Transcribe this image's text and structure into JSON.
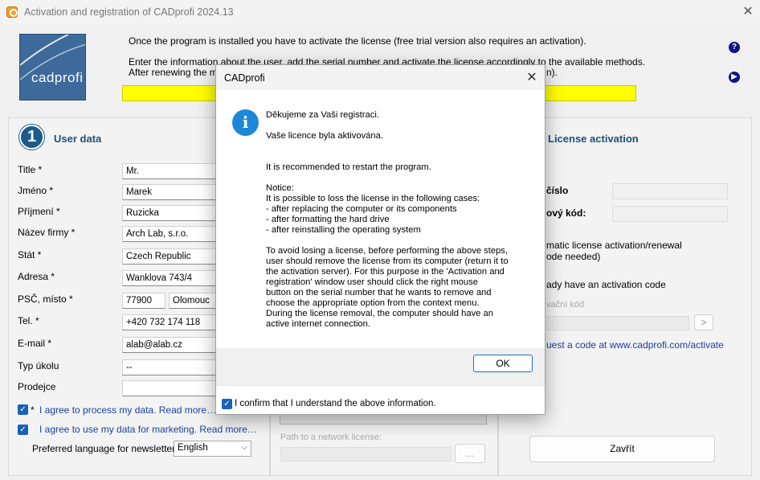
{
  "window": {
    "title": "Activation and registration of CADprofi  2024.13"
  },
  "logo": {
    "text": "cadprofi"
  },
  "intro": {
    "line1": "Once the program is installed you have to activate the license (free trial version also requires an activation).",
    "line2": "Enter the information about the user, add the serial number and activate the license accordingly to the available methods.",
    "line3": "After renewing the ma",
    "line3_tail": "n)."
  },
  "user_data": {
    "step": "1",
    "title": "User data",
    "fields": [
      {
        "label": "Title *",
        "value": "Mr."
      },
      {
        "label": "Jméno *",
        "value": "Marek"
      },
      {
        "label": "Příjmení *",
        "value": "Ruzicka"
      },
      {
        "label": "Název firmy *",
        "value": "Arch Lab, s.r.o."
      },
      {
        "label": "Stát *",
        "value": "Czech Republic"
      },
      {
        "label": "Adresa *",
        "value": "Wanklova 743/4"
      },
      {
        "label": "PSČ, místo *",
        "value": "77900",
        "value2": "Olomouc"
      },
      {
        "label": "Tel. *",
        "value": "+420 732 174 118"
      },
      {
        "label": "E-mail *",
        "value": "alab@alab.cz"
      },
      {
        "label": "Typ úkolu",
        "value": "--"
      },
      {
        "label": "Prodejce",
        "value": ""
      }
    ],
    "agree_process": "I agree to process my data. Read more…",
    "agree_process_star": "*",
    "agree_marketing": "I agree to use my data for marketing. Read more…",
    "newsletter_label": "Preferred language for newsletters",
    "newsletter_lang": "English"
  },
  "middle": {
    "network_path_label": "Path to a network license:",
    "browse_label": "..."
  },
  "license": {
    "title": "License activation",
    "serial_label": "číslo",
    "code_label": "ový kód:",
    "auto_line1": "matic license activation/renewal",
    "auto_line2": "ode needed)",
    "have_code": "ady have an activation code",
    "activation_code_placeholder": "vační kód",
    "go_label": ">",
    "request_link": "uest a code at www.cadprofi.com/activate",
    "close_label": "Zavřít"
  },
  "dialog": {
    "title": "CADprofi",
    "lines": [
      "Děkujeme za Vaši registraci.",
      "Vaše licence byla aktivována.",
      "It is recommended to restart the program.",
      "Notice:",
      "It is possible to loss the license in the following cases:",
      "- after replacing the computer or its components",
      "- after formatting the hard drive",
      "- after reinstalling the operating system",
      "To avoid losing a license, before performing the above steps,",
      "user should remove the license from its computer (return it to",
      "the activation server). For this purpose in the 'Activation and",
      "registration' window user should click the right mouse",
      "button on the serial number that he wants to remove and",
      "choose the appropriate option from the context menu.",
      "During the license removal, the computer should have an",
      "active internet connection."
    ],
    "ok_label": "OK",
    "confirm_label": "I confirm that I understand the above information."
  }
}
